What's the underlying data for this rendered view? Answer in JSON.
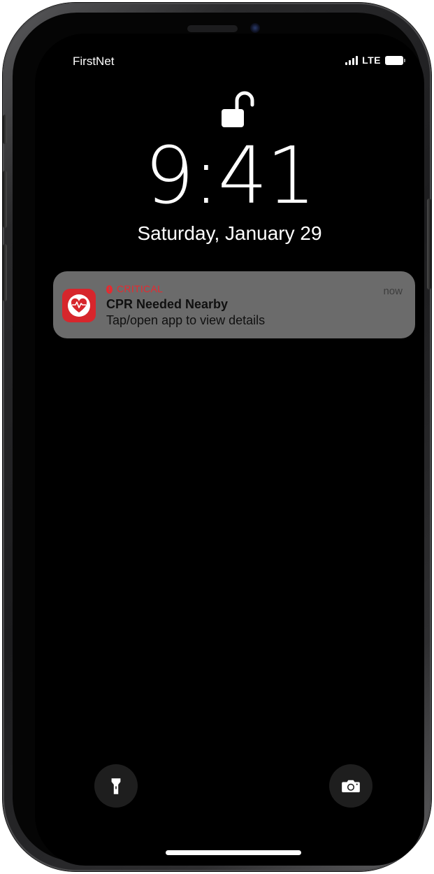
{
  "status_bar": {
    "carrier": "FirstNet",
    "network": "LTE",
    "signal_bars": 4,
    "battery_level": 1.0
  },
  "lock_screen": {
    "lock_state_icon": "unlocked-padlock-icon",
    "time": "9:41",
    "date": "Saturday, January 29"
  },
  "notification": {
    "app_icon": "heart-pulse-icon",
    "critical_icon": "alert-icon",
    "critical_label": "CRITICAL",
    "timestamp": "now",
    "title": "CPR Needed Nearby",
    "body": "Tap/open app to view details",
    "accent_color": "#d7262c"
  },
  "quick_actions": {
    "flashlight_icon": "flashlight-icon",
    "camera_icon": "camera-icon"
  }
}
